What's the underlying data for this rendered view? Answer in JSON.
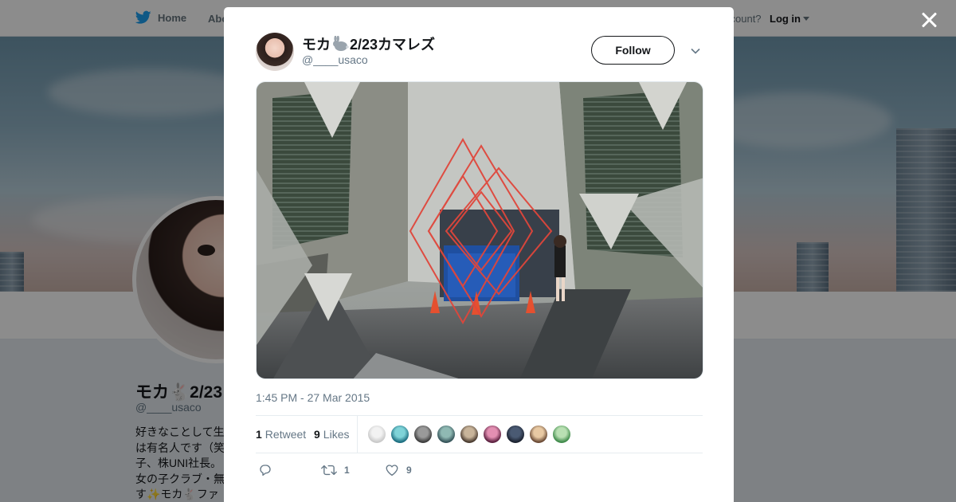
{
  "nav": {
    "home_label": "Home",
    "about_label": "Abo",
    "account_text": "ccount?",
    "login_label": "Log in"
  },
  "profile": {
    "name": "モカ🐇2/23",
    "handle": "@____usaco",
    "bio": "好きなことして生は有名人です（笑子、株UNI社長。女の子クラブ・無す✨モカ🐇ファ"
  },
  "tweet": {
    "author_name_prefix": "モカ",
    "author_name_suffix": "2/23カマレズ",
    "author_handle": "@____usaco",
    "follow_label": "Follow",
    "timestamp": "1:45 PM - 27 Mar 2015",
    "retweets_count": "1",
    "retweets_label": "Retweet",
    "likes_count": "9",
    "likes_label": "Likes",
    "reply_count": "",
    "retweet_action_count": "1",
    "like_action_count": "9"
  },
  "likers": [
    {
      "color_a": "#f2f2f2",
      "color_b": "#c9c9c9"
    },
    {
      "color_a": "#7fd3d8",
      "color_b": "#1d6e80"
    },
    {
      "color_a": "#9a9a9a",
      "color_b": "#3d3d3d"
    },
    {
      "color_a": "#8fb9b3",
      "color_b": "#36545a"
    },
    {
      "color_a": "#c8b49a",
      "color_b": "#4a3b30"
    },
    {
      "color_a": "#e38fb2",
      "color_b": "#5c2140"
    },
    {
      "color_a": "#4a5a73",
      "color_b": "#1b2230"
    },
    {
      "color_a": "#e8c9a3",
      "color_b": "#6a4a35"
    },
    {
      "color_a": "#b9e0b3",
      "color_b": "#3f8a4a"
    }
  ],
  "colors": {
    "accent": "#1da1f2",
    "text_primary": "#14171a",
    "text_secondary": "#657786",
    "overlay": "rgba(0,0,0,0.45)"
  },
  "icons": {
    "nav_home": "bird-icon",
    "close": "close-icon",
    "dropdown": "chevron-down-icon",
    "reply": "reply-icon",
    "retweet": "retweet-icon",
    "like": "heart-icon"
  }
}
